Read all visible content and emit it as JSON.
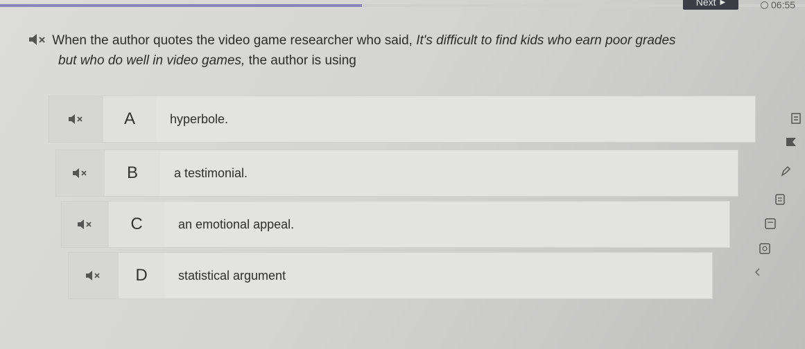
{
  "header": {
    "progress_fraction": 0.45,
    "next_label": "Next",
    "timer": "06:55"
  },
  "question": {
    "line1_prefix": "When the author quotes the video game researcher who said, ",
    "line1_quote": "It's difficult to find kids who earn poor grades",
    "line2_quote": "but who do well in video games,",
    "line2_suffix": " the author is using"
  },
  "options": [
    {
      "letter": "A",
      "text": "hyperbole."
    },
    {
      "letter": "B",
      "text": "a testimonial."
    },
    {
      "letter": "C",
      "text": "an emotional appeal."
    },
    {
      "letter": "D",
      "text": "statistical argument"
    }
  ],
  "icons": {
    "audio": "speaker-mute-icon",
    "tools": [
      "line-reader-icon",
      "flag-icon",
      "highlighter-icon",
      "notepad-icon",
      "calculator-icon",
      "answer-eliminator-icon",
      "collapse-icon"
    ]
  },
  "colors": {
    "progress": "#8a84b6",
    "next_button": "#3d3d46"
  }
}
